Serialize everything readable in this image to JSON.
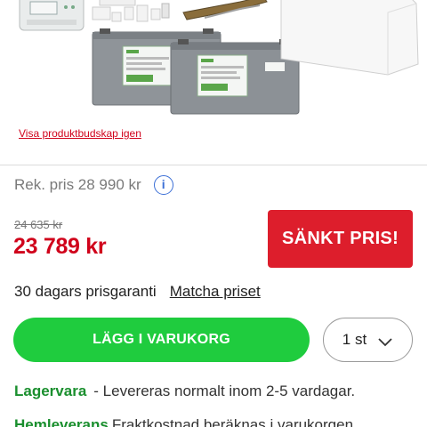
{
  "product": {
    "image_alt": "Solcellspaket med batterier, regulator och tillbehör",
    "show_package_link": "Visa produktbudskap igen"
  },
  "pricing": {
    "recommended_price": "Rek. pris 28 990 kr",
    "old_price": "24 635 kr",
    "new_price": "23 789 kr",
    "sale_badge": "SÄNKT PRIS!",
    "info_icon": "i"
  },
  "guarantee": {
    "text": "30 dagars prisgaranti",
    "match_link": "Matcha priset"
  },
  "purchase": {
    "add_to_cart": "LÄGG I VARUKORG",
    "quantity": "1 st",
    "accent_green": "#1fcc3e",
    "sale_red": "#dd1e2c"
  },
  "availability": {
    "stock_label": "Lagervara",
    "stock_text": "- Levereras normalt inom 2-5 vardagar.",
    "delivery_label": "Hemleverans",
    "delivery_text": "Fraktkostnad beräknas i varukorgen"
  }
}
